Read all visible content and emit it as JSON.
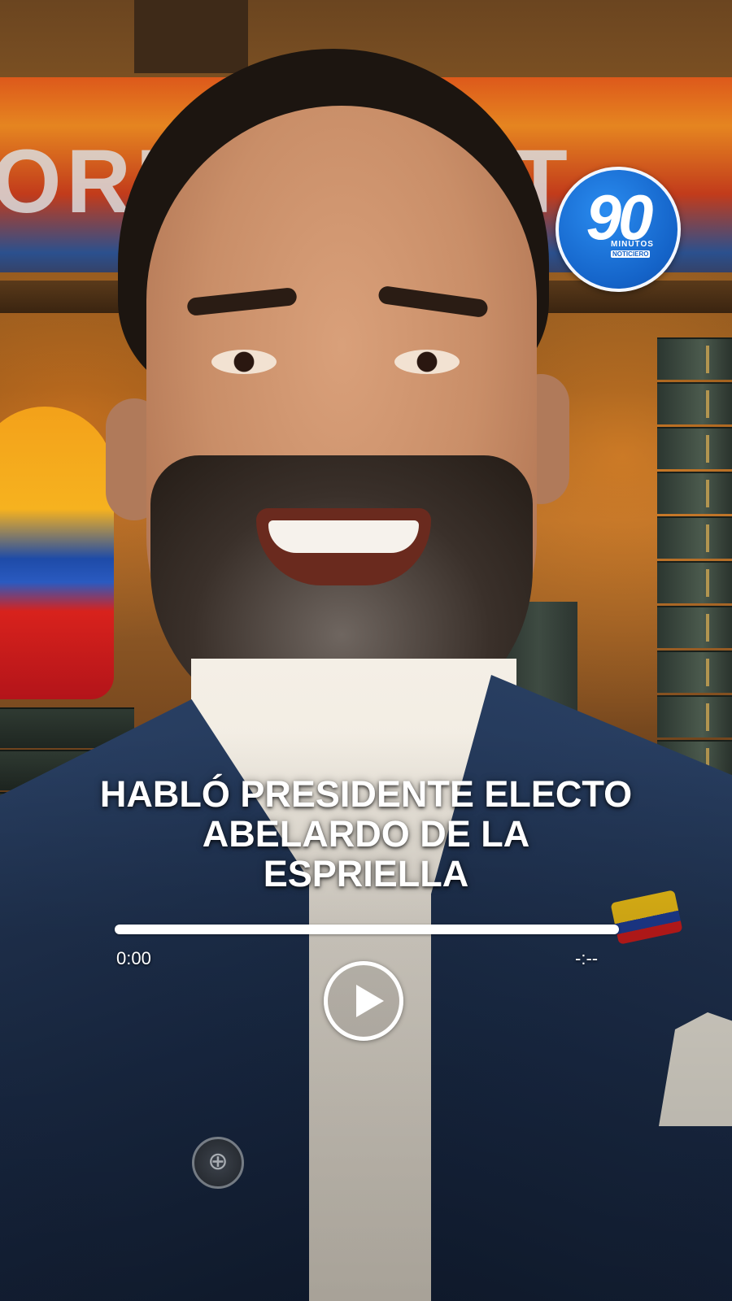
{
  "video": {
    "headline_lines": [
      "HABLÓ PRESIDENTE ELECTO",
      "ABELARDO DE LA",
      "ESPRIELLA"
    ],
    "progress_fraction": 0.0,
    "time_current": "0:00",
    "time_total": "-:--",
    "play_icon": "play-icon"
  },
  "logo": {
    "number": "90",
    "line1": "MINUTOS",
    "line2": "NOTICIERO",
    "brand_color": "#1463c8"
  },
  "background": {
    "banner_text": "ORRE    A PAT"
  }
}
